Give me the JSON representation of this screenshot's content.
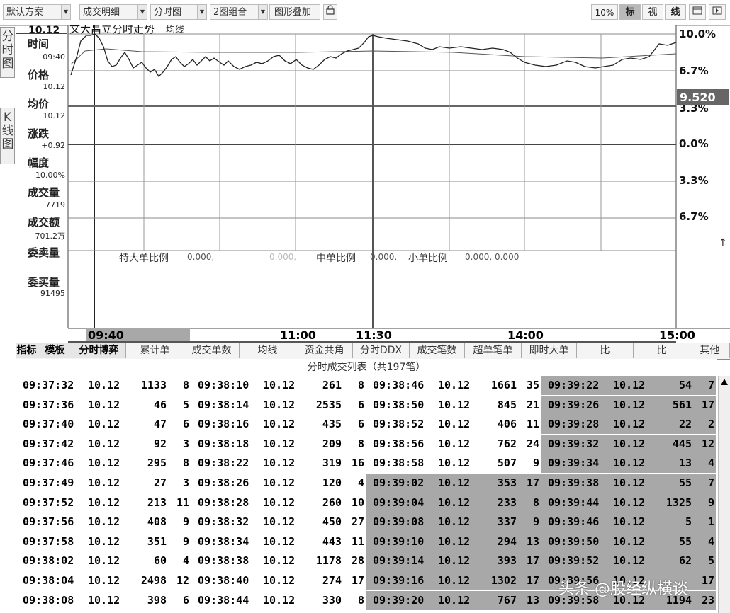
{
  "toolbar": {
    "dropdowns": [
      "默认方案",
      "成交明细",
      "分时图",
      "2图组合",
      "图形叠加"
    ],
    "lock_icon": "lock-icon",
    "zoom": "10%",
    "btn_biao": "标",
    "btn_shi": "视",
    "btn_xian": "线",
    "btn_window": "window-icon",
    "btn_next": "next-icon"
  },
  "left_tabs": [
    "分时图",
    "K线图"
  ],
  "info": {
    "price_top": "10.12",
    "labels": [
      "时间",
      "价格",
      "均价",
      "涨跌",
      "幅度",
      "成交量",
      "成交额",
      "委卖量",
      "委买量"
    ],
    "values": [
      "09:40",
      "10.12",
      "10.12",
      "+0.92",
      "10.00%",
      "7719",
      "701.2万",
      "",
      "91495"
    ]
  },
  "chart": {
    "title": "文大昌立分时走势",
    "avg_label": "均线",
    "y_labels": [
      "10.0%",
      "6.7%",
      "3.3%",
      "0.0%",
      "3.3%",
      "6.7%"
    ],
    "current_price": "9.520",
    "up_arrow": "↑",
    "stats": {
      "super_label": "特大单比例",
      "super_value": "0.000,",
      "big_value": "0.000,",
      "mid_label": "中单比例",
      "mid_value": "0.000,",
      "small_label": "小单比例",
      "small_value": "0.000, 0.000"
    },
    "cursor_time": "09:40",
    "time_labels": [
      "11:00",
      "11:30",
      "14:00",
      "15:00"
    ]
  },
  "func_tabs": [
    "指标",
    "模板",
    "分时博弈",
    "累计单",
    "成交单数",
    "均线",
    "资金共角",
    "分时DDX",
    "成交笔数",
    "超单笔单",
    "即时大单",
    "比",
    "比",
    "其他"
  ],
  "list_title": "分时成交列表（共197笔）",
  "trades": [
    [
      [
        "09:37:32",
        "10.12",
        "1133",
        "8"
      ],
      [
        "09:37:36",
        "10.12",
        "46",
        "5"
      ],
      [
        "09:37:40",
        "10.12",
        "47",
        "6"
      ],
      [
        "09:37:42",
        "10.12",
        "92",
        "3"
      ],
      [
        "09:37:46",
        "10.12",
        "295",
        "8"
      ],
      [
        "09:37:49",
        "10.12",
        "27",
        "3"
      ],
      [
        "09:37:52",
        "10.12",
        "213",
        "11"
      ],
      [
        "09:37:56",
        "10.12",
        "408",
        "9"
      ],
      [
        "09:37:58",
        "10.12",
        "351",
        "9"
      ],
      [
        "09:38:02",
        "10.12",
        "60",
        "4"
      ],
      [
        "09:38:04",
        "10.12",
        "2498",
        "12"
      ],
      [
        "09:38:08",
        "10.12",
        "398",
        "6"
      ]
    ],
    [
      [
        "09:38:10",
        "10.12",
        "261",
        "8"
      ],
      [
        "09:38:14",
        "10.12",
        "2535",
        "6"
      ],
      [
        "09:38:16",
        "10.12",
        "435",
        "6"
      ],
      [
        "09:38:18",
        "10.12",
        "209",
        "8"
      ],
      [
        "09:38:22",
        "10.12",
        "319",
        "16"
      ],
      [
        "09:38:26",
        "10.12",
        "120",
        "4"
      ],
      [
        "09:38:28",
        "10.12",
        "260",
        "10"
      ],
      [
        "09:38:32",
        "10.12",
        "450",
        "27"
      ],
      [
        "09:38:34",
        "10.12",
        "443",
        "11"
      ],
      [
        "09:38:38",
        "10.12",
        "1178",
        "28"
      ],
      [
        "09:38:40",
        "10.12",
        "274",
        "17"
      ],
      [
        "09:38:44",
        "10.12",
        "330",
        "8"
      ]
    ],
    [
      [
        "09:38:46",
        "10.12",
        "1661",
        "35"
      ],
      [
        "09:38:50",
        "10.12",
        "845",
        "21"
      ],
      [
        "09:38:52",
        "10.12",
        "406",
        "11"
      ],
      [
        "09:38:56",
        "10.12",
        "762",
        "24"
      ],
      [
        "09:38:58",
        "10.12",
        "507",
        "9"
      ],
      [
        "09:39:02",
        "10.12",
        "353",
        "17"
      ],
      [
        "09:39:04",
        "10.12",
        "233",
        "8"
      ],
      [
        "09:39:08",
        "10.12",
        "337",
        "9"
      ],
      [
        "09:39:10",
        "10.12",
        "294",
        "13"
      ],
      [
        "09:39:14",
        "10.12",
        "393",
        "17"
      ],
      [
        "09:39:16",
        "10.12",
        "1302",
        "17"
      ],
      [
        "09:39:20",
        "10.12",
        "767",
        "13"
      ]
    ],
    [
      [
        "09:39:22",
        "10.12",
        "54",
        "7"
      ],
      [
        "09:39:26",
        "10.12",
        "561",
        "17"
      ],
      [
        "09:39:28",
        "10.12",
        "22",
        "2"
      ],
      [
        "09:39:32",
        "10.12",
        "445",
        "12"
      ],
      [
        "09:39:34",
        "10.12",
        "13",
        "4"
      ],
      [
        "09:39:38",
        "10.12",
        "55",
        "7"
      ],
      [
        "09:39:44",
        "10.12",
        "1325",
        "9"
      ],
      [
        "09:39:46",
        "10.12",
        "5",
        "1"
      ],
      [
        "09:39:50",
        "10.12",
        "55",
        "4"
      ],
      [
        "09:39:52",
        "10.12",
        "62",
        "5"
      ],
      [
        "09:39:56",
        "10.12",
        "",
        "17"
      ],
      [
        "09:39:58",
        "10.12",
        "1194",
        "23"
      ]
    ]
  ],
  "highlight_start_rows": [
    12,
    12,
    5,
    0
  ],
  "watermark": "头条 @股经纵横谈"
}
